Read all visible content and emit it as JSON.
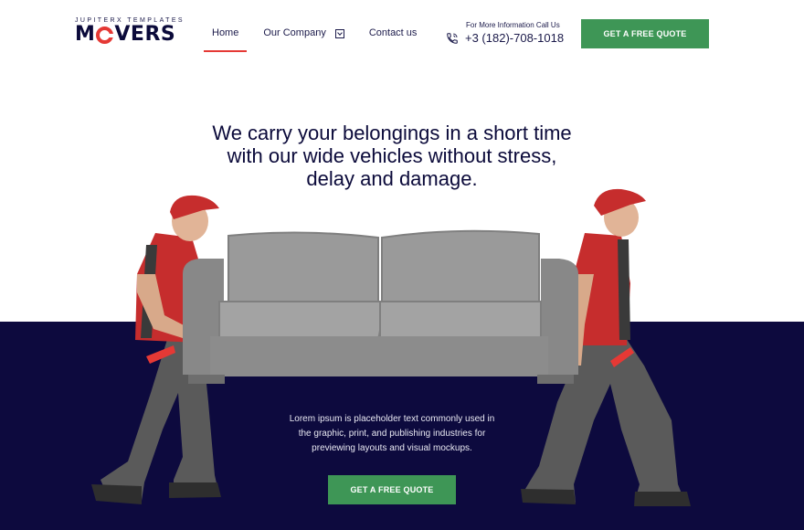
{
  "brand": {
    "tagline": "JUPITERX TEMPLATES",
    "name_left": "M",
    "name_right": "VERS"
  },
  "nav": {
    "items": [
      {
        "label": "Home",
        "active": true
      },
      {
        "label": "Our Company",
        "has_submenu": true
      },
      {
        "label": "Contact us"
      }
    ]
  },
  "contact": {
    "caption": "For More Information Call Us",
    "phone": "+3 (182)-708-1018",
    "icon": "phone-icon"
  },
  "header_cta": {
    "label": "GET A FREE QUOTE"
  },
  "hero": {
    "title_lines": [
      "We carry your belongings in a short time",
      "with our wide vehicles without stress,",
      "delay and damage."
    ],
    "body_lines": [
      "Lorem ipsum is placeholder text commonly used in",
      "the graphic, print, and publishing industries for",
      "previewing layouts and visual mockups."
    ],
    "cta_label": "GET A FREE QUOTE"
  },
  "colors": {
    "navy": "#0d0a3e",
    "accent_green": "#3e9656",
    "accent_red": "#e53935",
    "mover_shirt": "#c62d2d",
    "mover_pants": "#5a5a5a",
    "sofa": "#8f8f8f"
  }
}
